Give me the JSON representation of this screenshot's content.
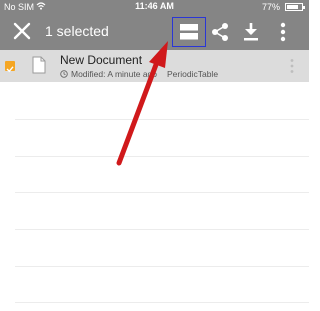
{
  "status_bar": {
    "carrier": "No SIM",
    "time": "11:46 AM",
    "battery_percent_label": "77%",
    "battery_level": 0.77
  },
  "action_bar": {
    "title": "1 selected",
    "icons": {
      "close": "close-icon",
      "stack": "stack-icon",
      "share": "share-icon",
      "download": "download-icon",
      "more": "more-vertical-icon"
    }
  },
  "files": [
    {
      "name": "New Document",
      "modified": "Modified: A minute ago",
      "tag": "PeriodicTable",
      "selected": true
    }
  ],
  "colors": {
    "toolbar": "#858585",
    "selected_row": "#dcdcdc",
    "checkbox": "#f5a623",
    "highlight_box": "#2a36d6",
    "annotation_arrow": "#d0191b"
  }
}
